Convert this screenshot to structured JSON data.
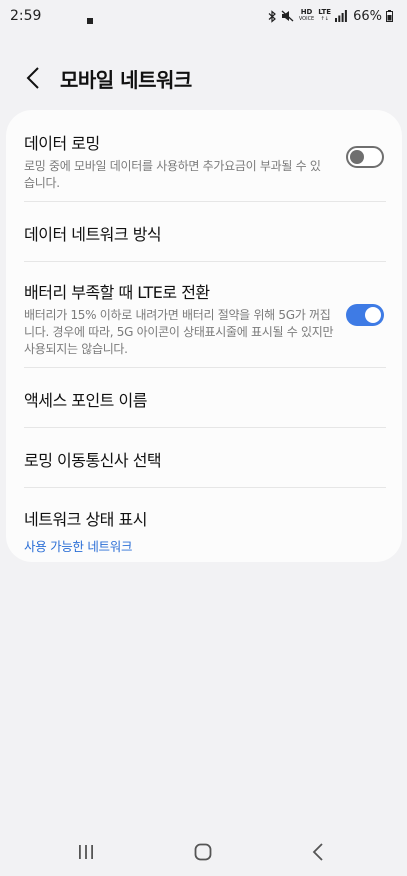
{
  "status_bar": {
    "time": "2:59",
    "hd_label": "HD",
    "hd_sub": "VOICE",
    "lte_label": "LTE",
    "battery": "66%"
  },
  "header": {
    "title": "모바일 네트워크"
  },
  "settings": [
    {
      "title": "데이터 로밍",
      "description": "로밍 중에 모바일 데이터를 사용하면 추가요금이 부과될 수 있습니다.",
      "toggle": false
    },
    {
      "title": "데이터 네트워크 방식"
    },
    {
      "title": "배터리 부족할 때 LTE로 전환",
      "description": "배터리가 15% 이하로 내려가면 배터리 절약을 위해 5G가 꺼집니다. 경우에 따라, 5G 아이콘이 상태표시줄에 표시될 수 있지만 사용되지는 않습니다.",
      "toggle": true
    },
    {
      "title": "액세스 포인트 이름"
    },
    {
      "title": "로밍 이동통신사 선택"
    },
    {
      "title": "네트워크 상태 표시",
      "subtitle": "사용 가능한 네트워크"
    }
  ],
  "colors": {
    "accent": "#3e7be5",
    "link": "#2c6fd6",
    "background": "#f2f2f4"
  }
}
